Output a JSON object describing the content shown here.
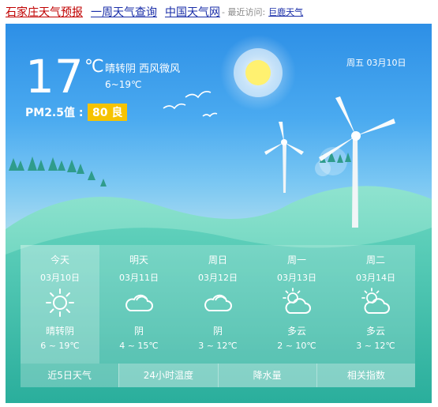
{
  "topbar": {
    "link_local": "石家庄天气预报",
    "link_week": "一周天气查询",
    "link_cn": "中国天气网",
    "recent_label": "- 最近访问:",
    "recent_city": "巨鹿天气"
  },
  "current": {
    "temperature": "17",
    "unit": "℃",
    "condition": "晴转阴 西风微风",
    "range": "6~19℃",
    "pm_label": "PM2.5值 :",
    "aqi_value": "80 良",
    "date": "周五 03月10日"
  },
  "forecast": [
    {
      "day": "今天",
      "date": "03月10日",
      "icon": "sun-icon",
      "condition": "晴转阴",
      "temp": "6 ~ 19℃"
    },
    {
      "day": "明天",
      "date": "03月11日",
      "icon": "cloud-icon",
      "condition": "阴",
      "temp": "4 ~ 15℃"
    },
    {
      "day": "周日",
      "date": "03月12日",
      "icon": "cloud-icon",
      "condition": "阴",
      "temp": "3 ~ 12℃"
    },
    {
      "day": "周一",
      "date": "03月13日",
      "icon": "partly-cloudy-icon",
      "condition": "多云",
      "temp": "2 ~ 10℃"
    },
    {
      "day": "周二",
      "date": "03月14日",
      "icon": "partly-cloudy-icon",
      "condition": "多云",
      "temp": "3 ~ 12℃"
    }
  ],
  "tabs": [
    "近5日天气",
    "24小时温度",
    "降水量",
    "相关指数"
  ],
  "colors": {
    "aqi_badge": "#f6c300",
    "sky_top": "#2d8fe6",
    "hill": "#2db0a0",
    "link_red": "#c00000",
    "link_blue": "#1a2ea8"
  }
}
